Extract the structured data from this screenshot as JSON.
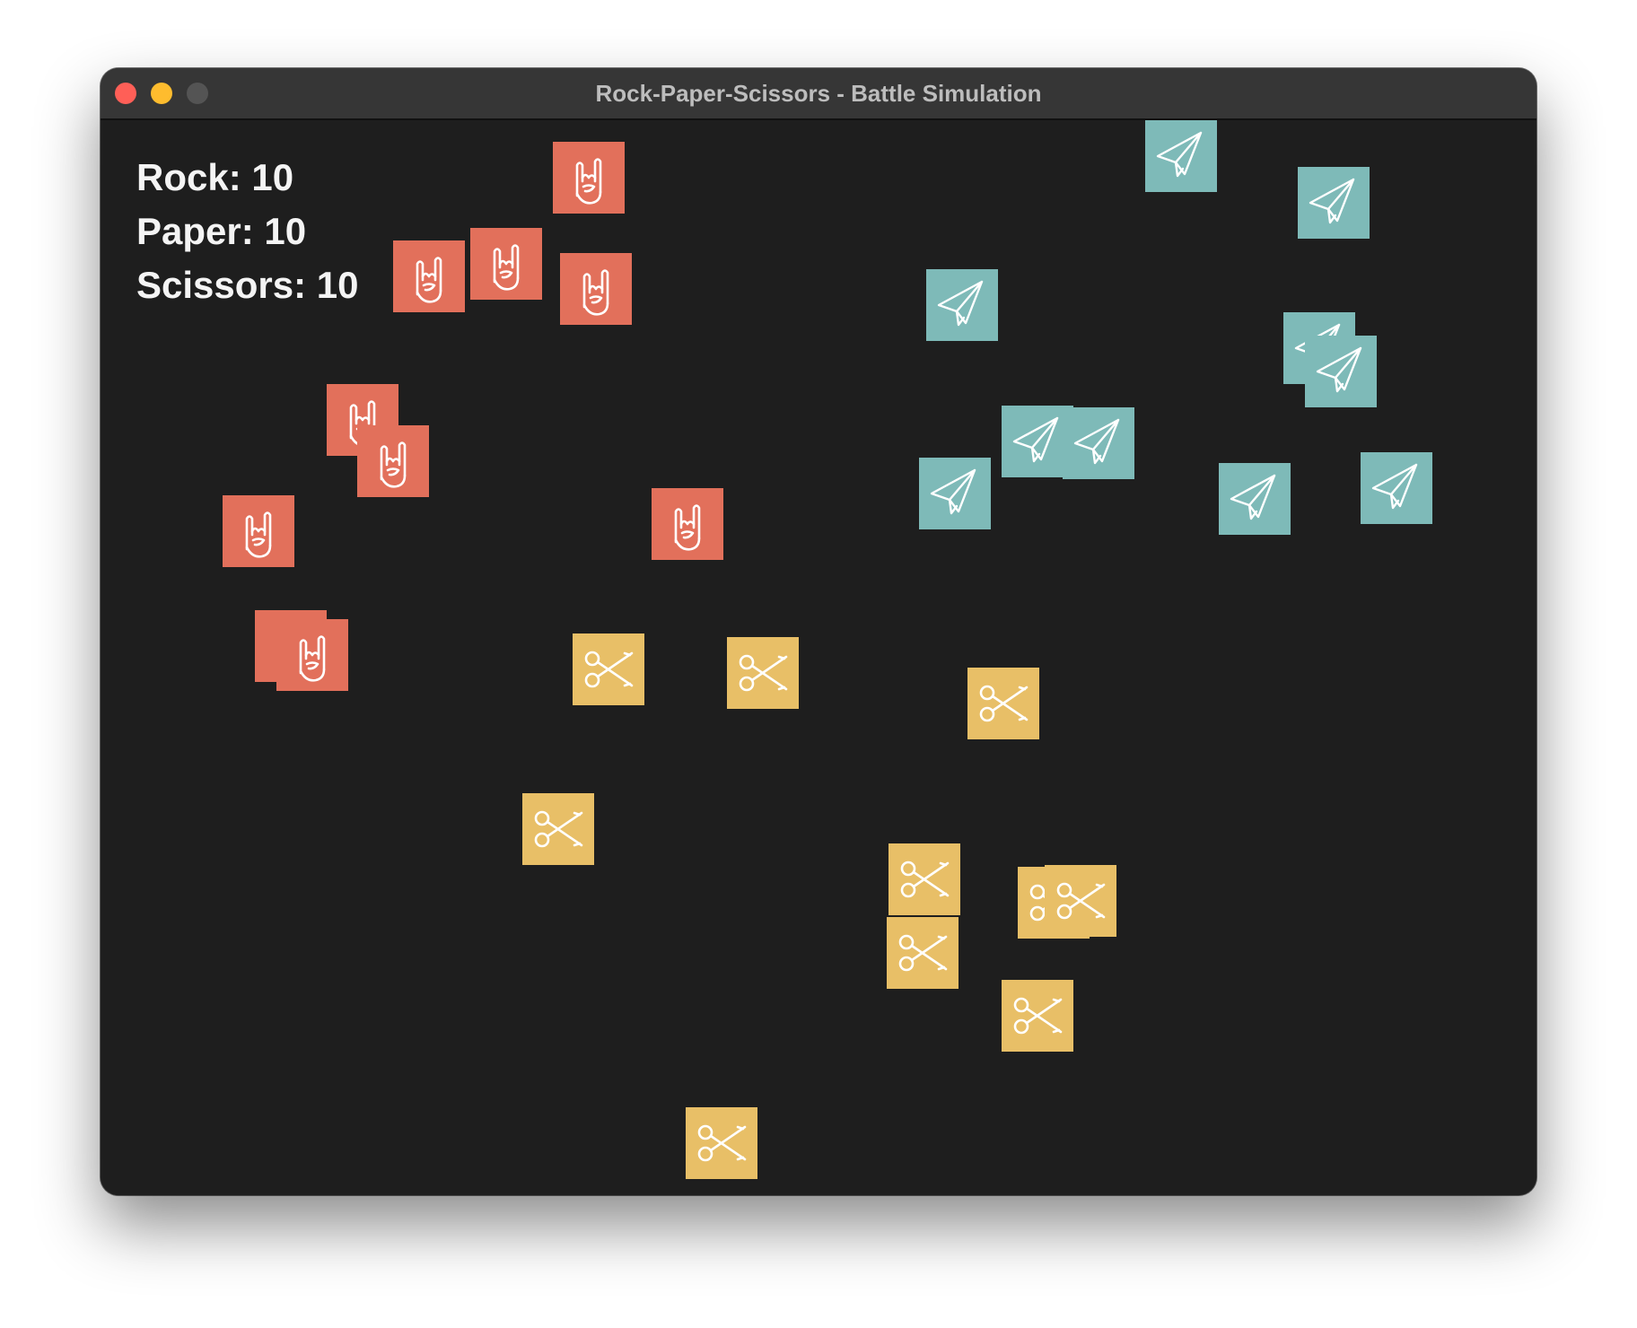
{
  "window": {
    "title": "Rock-Paper-Scissors - Battle Simulation"
  },
  "scoreboard": {
    "rock": "Rock: 10",
    "paper": "Paper: 10",
    "scissors": "Scissors: 10"
  },
  "colors": {
    "rock": "#e2705b",
    "paper": "#7ebab8",
    "scissors": "#e8bf67",
    "background": "#1e1e1e"
  },
  "icons": {
    "rock": "rock-hand-icon",
    "paper": "paper-plane-icon",
    "scissors": "scissors-icon"
  }
}
